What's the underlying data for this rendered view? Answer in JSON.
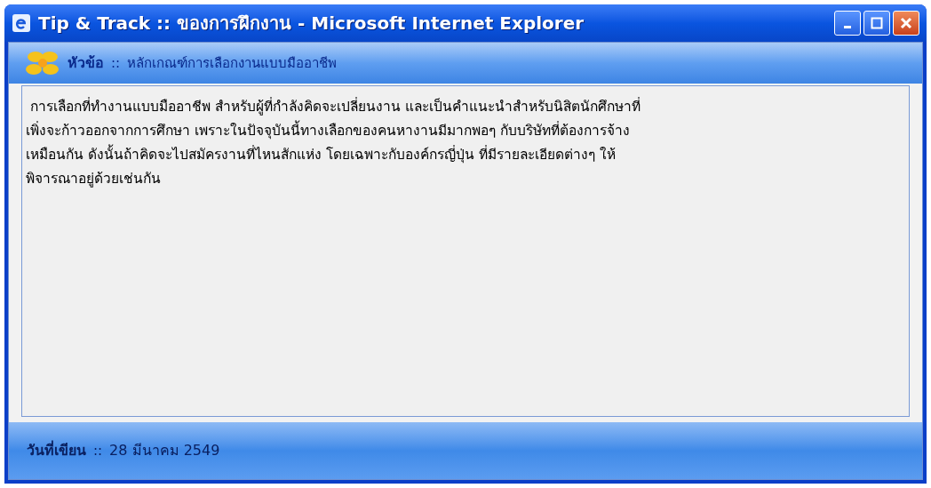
{
  "window": {
    "title": "Tip & Track :: ของการฝึกงาน - Microsoft Internet Explorer",
    "controls": [
      {
        "kind": "minimize"
      },
      {
        "kind": "maximize"
      },
      {
        "kind": "close"
      }
    ]
  },
  "header": {
    "label": "หัวข้อ",
    "separator": "::",
    "value": "หลักเกณฑ์การเลือกงานแบบมืออาชีพ"
  },
  "body": {
    "lines": [
      " การเลือกที่ทำงานแบบมืออาชีพ สำหรับผู้ที่กำลังคิดจะเปลี่ยนงาน และเป็นคำแนะนำสำหรับนิสิตนักศึกษาที่",
      "เพิ่งจะก้าวออกจากการศึกษา เพราะในปัจจุบันนี้ทางเลือกของคนหางานมีมากพอๆ กับบริษัทที่ต้องการจ้าง",
      "เหมือนกัน ดังนั้นถ้าคิดจะไปสมัครงานที่ไหนสักแห่ง โดยเฉพาะกับองค์กรญี่ปุ่น ที่มีรายละเอียดต่างๆ ให้",
      "พิจารณาอยู่ด้วยเช่นกัน"
    ]
  },
  "footer": {
    "label": "วันที่เขียน",
    "separator": "::",
    "value": "28 มีนาคม 2549"
  }
}
